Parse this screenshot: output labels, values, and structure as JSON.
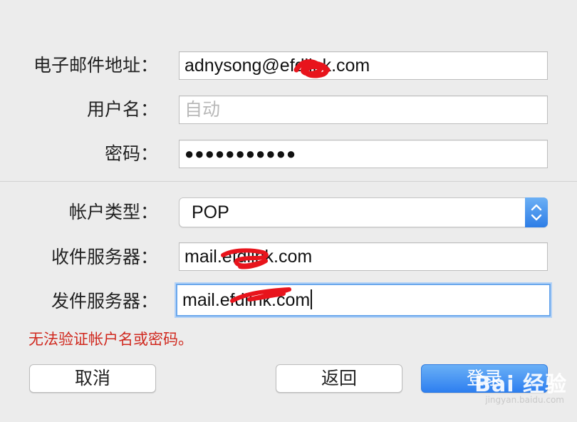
{
  "form": {
    "email": {
      "label": "电子邮件地址：",
      "value": "adnysong@efdlink.com"
    },
    "username": {
      "label": "用户名：",
      "placeholder": "自动"
    },
    "password": {
      "label": "密码：",
      "value": "●●●●●●●●●●●"
    },
    "account_type": {
      "label": "帐户类型：",
      "value": "POP"
    },
    "incoming_server": {
      "label": "收件服务器：",
      "value": "mail.efdlink.com"
    },
    "outgoing_server": {
      "label": "发件服务器：",
      "value": "mail.efdlink.com"
    }
  },
  "error_message": "无法验证帐户名或密码。",
  "buttons": {
    "cancel": "取消",
    "back": "返回",
    "sign_in": "登录"
  },
  "watermark": {
    "brand": "Bai 经验",
    "url": "jingyan.baidu.com"
  },
  "colors": {
    "accent": "#2e7ff0",
    "error": "#d0281e",
    "redaction": "#e8141c"
  }
}
